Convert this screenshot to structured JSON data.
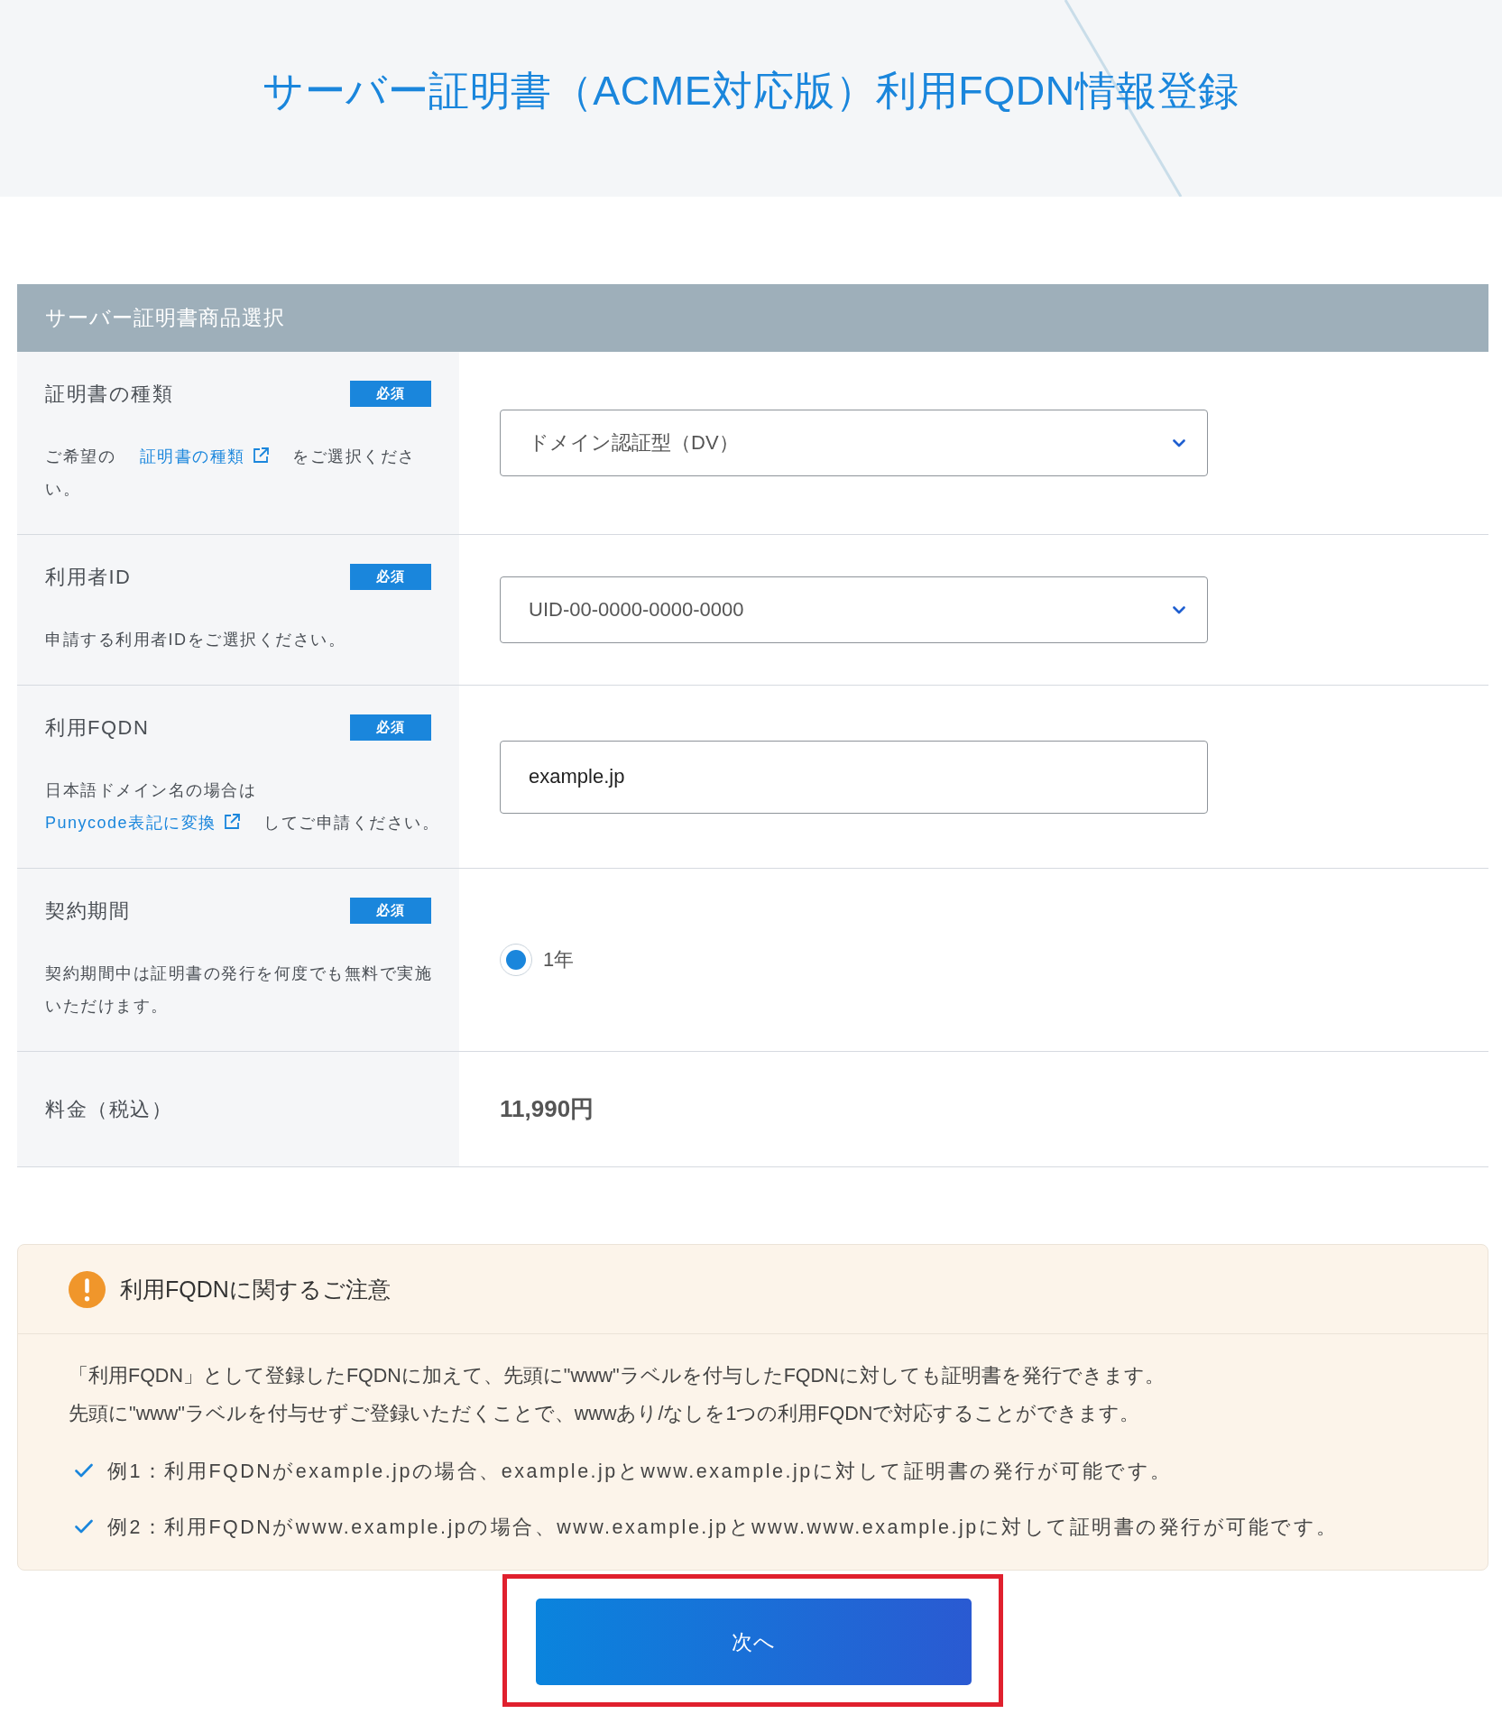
{
  "header": {
    "title": "サーバー証明書（ACME対応版）利用FQDN情報登録"
  },
  "section": {
    "title": "サーバー証明書商品選択"
  },
  "rows": [
    {
      "kind": "select",
      "label": "証明書の種類",
      "badge": "必須",
      "description": [
        {
          "kind": "text",
          "text": "ご希望の "
        },
        {
          "kind": "link",
          "text": "証明書の種類",
          "external": true
        },
        {
          "kind": "text",
          "text": " をご選択ください。"
        }
      ],
      "value": "ドメイン認証型（DV）"
    },
    {
      "kind": "select",
      "label": "利用者ID",
      "badge": "必須",
      "description": [
        {
          "kind": "text",
          "text": "申請する利用者IDをご選択ください。"
        }
      ],
      "value": "UID-00-0000-0000-0000"
    },
    {
      "kind": "input",
      "label": "利用FQDN",
      "badge": "必須",
      "description": [
        {
          "kind": "text",
          "text": "日本語ドメイン名の場合は "
        },
        {
          "kind": "link",
          "text": "Punycode表記に変換",
          "external": true
        },
        {
          "kind": "text",
          "text": " してご申請ください。"
        }
      ],
      "value": "example.jp"
    },
    {
      "kind": "radio",
      "label": "契約期間",
      "badge": "必須",
      "description": [
        {
          "kind": "text",
          "text": "契約期間中は証明書の発行を何度でも無料で実施いただけます。"
        }
      ],
      "options": [
        {
          "label": "1年",
          "selected": true
        }
      ]
    },
    {
      "kind": "price",
      "label": "料金（税込）",
      "value": "11,990円"
    }
  ],
  "notice": {
    "title": "利用FQDNに関するご注意",
    "paragraphs": [
      "「利用FQDN」として登録したFQDNに加えて、先頭に\"www\"ラベルを付与したFQDNに対しても証明書を発行できます。",
      "先頭に\"www\"ラベルを付与せずご登録いただくことで、wwwあり/なしを1つの利用FQDNで対応することができます。"
    ],
    "examples": [
      "例1：利用FQDNがexample.jpの場合、example.jpとwww.example.jpに対して証明書の発行が可能です。",
      "例2：利用FQDNがwww.example.jpの場合、www.example.jpとwww.www.example.jpに対して証明書の発行が可能です。"
    ]
  },
  "next_button": {
    "label": "次へ",
    "highlighted": true
  }
}
